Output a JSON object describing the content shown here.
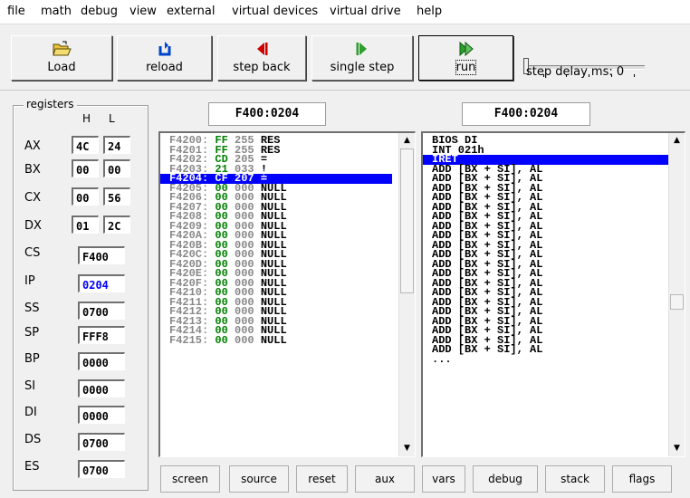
{
  "menu": [
    "file",
    "math",
    "debug",
    "view",
    "external",
    "virtual devices",
    "virtual drive",
    "help"
  ],
  "toolbar": {
    "load": "Load",
    "reload": "reload",
    "step_back": "step back",
    "single_step": "single step",
    "run": "run",
    "step_delay": "step delay ms: 0",
    "step_delay_value": 0
  },
  "registers": {
    "title": "registers",
    "h_label": "H",
    "l_label": "L",
    "split": [
      {
        "name": "AX",
        "h": "4C",
        "l": "24"
      },
      {
        "name": "BX",
        "h": "00",
        "l": "00"
      },
      {
        "name": "CX",
        "h": "00",
        "l": "56"
      },
      {
        "name": "DX",
        "h": "01",
        "l": "2C"
      }
    ],
    "full": [
      {
        "name": "CS",
        "value": "F400"
      },
      {
        "name": "IP",
        "value": "0204"
      },
      {
        "name": "SS",
        "value": "0700"
      },
      {
        "name": "SP",
        "value": "FFF8"
      },
      {
        "name": "BP",
        "value": "0000"
      },
      {
        "name": "SI",
        "value": "0000"
      },
      {
        "name": "DI",
        "value": "0000"
      },
      {
        "name": "DS",
        "value": "0700"
      },
      {
        "name": "ES",
        "value": "0700"
      }
    ]
  },
  "memory": {
    "address": "F400:0204",
    "rows": [
      {
        "addr": "F4200:",
        "hex": "FF",
        "dec": "255",
        "chr": "RES"
      },
      {
        "addr": "F4201:",
        "hex": "FF",
        "dec": "255",
        "chr": "RES"
      },
      {
        "addr": "F4202:",
        "hex": "CD",
        "dec": "205",
        "chr": "="
      },
      {
        "addr": "F4203:",
        "hex": "21",
        "dec": "033",
        "chr": "!"
      },
      {
        "addr": "F4204:",
        "hex": "CF",
        "dec": "207",
        "chr": "≟"
      },
      {
        "addr": "F4205:",
        "hex": "00",
        "dec": "000",
        "chr": "NULL"
      },
      {
        "addr": "F4206:",
        "hex": "00",
        "dec": "000",
        "chr": "NULL"
      },
      {
        "addr": "F4207:",
        "hex": "00",
        "dec": "000",
        "chr": "NULL"
      },
      {
        "addr": "F4208:",
        "hex": "00",
        "dec": "000",
        "chr": "NULL"
      },
      {
        "addr": "F4209:",
        "hex": "00",
        "dec": "000",
        "chr": "NULL"
      },
      {
        "addr": "F420A:",
        "hex": "00",
        "dec": "000",
        "chr": "NULL"
      },
      {
        "addr": "F420B:",
        "hex": "00",
        "dec": "000",
        "chr": "NULL"
      },
      {
        "addr": "F420C:",
        "hex": "00",
        "dec": "000",
        "chr": "NULL"
      },
      {
        "addr": "F420D:",
        "hex": "00",
        "dec": "000",
        "chr": "NULL"
      },
      {
        "addr": "F420E:",
        "hex": "00",
        "dec": "000",
        "chr": "NULL"
      },
      {
        "addr": "F420F:",
        "hex": "00",
        "dec": "000",
        "chr": "NULL"
      },
      {
        "addr": "F4210:",
        "hex": "00",
        "dec": "000",
        "chr": "NULL"
      },
      {
        "addr": "F4211:",
        "hex": "00",
        "dec": "000",
        "chr": "NULL"
      },
      {
        "addr": "F4212:",
        "hex": "00",
        "dec": "000",
        "chr": "NULL"
      },
      {
        "addr": "F4213:",
        "hex": "00",
        "dec": "000",
        "chr": "NULL"
      },
      {
        "addr": "F4214:",
        "hex": "00",
        "dec": "000",
        "chr": "NULL"
      },
      {
        "addr": "F4215:",
        "hex": "00",
        "dec": "000",
        "chr": "NULL"
      }
    ],
    "selected": 4
  },
  "disassembly": {
    "address": "F400:0204",
    "rows": [
      "BIOS DI",
      "INT 021h",
      "IRET",
      "ADD [BX + SI], AL",
      "ADD [BX + SI], AL",
      "ADD [BX + SI], AL",
      "ADD [BX + SI], AL",
      "ADD [BX + SI], AL",
      "ADD [BX + SI], AL",
      "ADD [BX + SI], AL",
      "ADD [BX + SI], AL",
      "ADD [BX + SI], AL",
      "ADD [BX + SI], AL",
      "ADD [BX + SI], AL",
      "ADD [BX + SI], AL",
      "ADD [BX + SI], AL",
      "ADD [BX + SI], AL",
      "ADD [BX + SI], AL",
      "ADD [BX + SI], AL",
      "ADD [BX + SI], AL",
      "ADD [BX + SI], AL",
      "ADD [BX + SI], AL",
      "ADD [BX + SI], AL",
      "..."
    ],
    "selected": 2
  },
  "bottom_buttons": [
    "screen",
    "source",
    "reset",
    "aux",
    "vars",
    "debug",
    "stack",
    "flags"
  ],
  "colors": {
    "selection": "#0000ff",
    "hex": "#008000",
    "ip": "#0000ff",
    "step_back_icon": "#cc0000",
    "single_step_icon": "#2e9e2e",
    "reload_icon": "#0044cc"
  }
}
